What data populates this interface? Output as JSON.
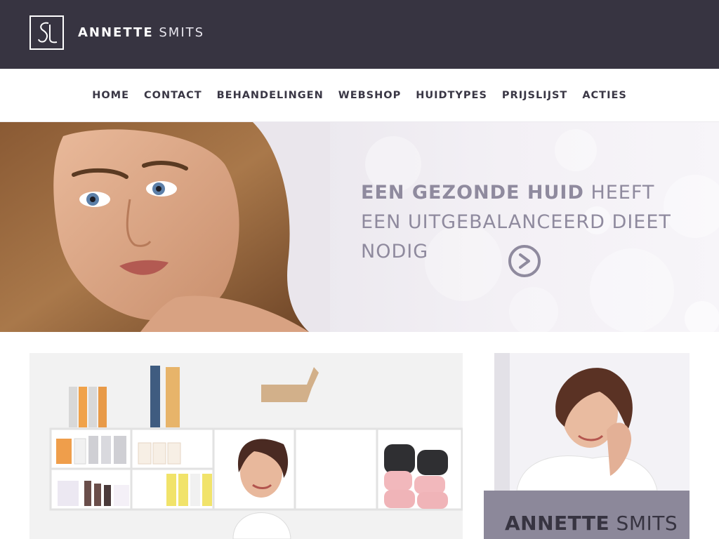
{
  "brand": {
    "name_bold": "ANNETTE",
    "name_light": "SMITS",
    "logo_icon": "sl-monogram-icon"
  },
  "nav": {
    "items": [
      {
        "label": "HOME"
      },
      {
        "label": "CONTACT"
      },
      {
        "label": "BEHANDELINGEN"
      },
      {
        "label": "WEBSHOP"
      },
      {
        "label": "HUIDTYPES"
      },
      {
        "label": "PRIJSLIJST"
      },
      {
        "label": "ACTIES"
      }
    ]
  },
  "hero": {
    "headline_bold": "EEN GEZONDE HUID",
    "headline_rest": " HEEFT EEN UITGEBALANCEERD DIEET NODIG",
    "arrow_icon": "chevron-right-circle-icon"
  },
  "profile": {
    "name_bold": "ANNETTE",
    "name_light": "SMITS"
  },
  "colors": {
    "header_bg": "#373441",
    "nav_text": "#3a3745",
    "hero_text": "#8f8a9e",
    "name_box_bg": "#8c889a"
  }
}
